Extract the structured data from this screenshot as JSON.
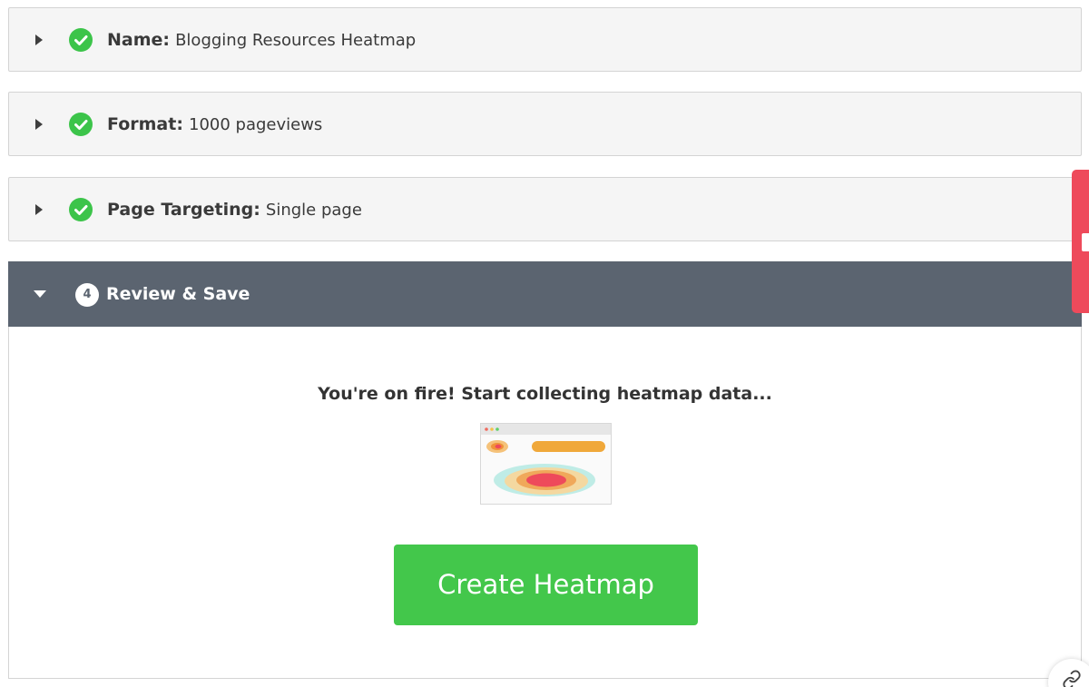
{
  "steps": [
    {
      "label": "Name",
      "separator": ":",
      "value": "Blogging Resources Heatmap",
      "status": "complete",
      "icon": "check-circle-icon"
    },
    {
      "label": "Format",
      "separator": ":",
      "value": "1000 pageviews",
      "status": "complete",
      "icon": "check-circle-icon"
    },
    {
      "label": "Page Targeting",
      "separator": ":",
      "value": "Single page",
      "status": "complete",
      "icon": "check-circle-icon"
    }
  ],
  "review": {
    "step_number": "4",
    "title": "Review & Save",
    "message": "You're on fire! Start collecting heatmap data...",
    "button_label": "Create Heatmap",
    "illustration": "heatmap-preview-illustration"
  },
  "colors": {
    "success": "#3cc44a",
    "button": "#43c74b",
    "header": "#5b6470",
    "side_tab": "#ee4a5b"
  },
  "icons": {
    "collapsed": "caret-right-icon",
    "expanded": "caret-down-icon",
    "link": "link-icon",
    "side_tab": "feedback-tab-icon"
  }
}
